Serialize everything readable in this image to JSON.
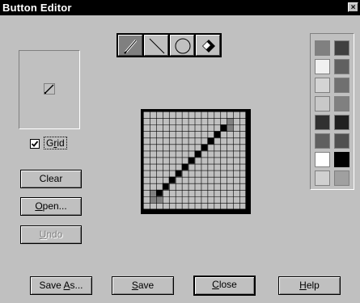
{
  "window": {
    "title": "Button Editor",
    "close_glyph": "×"
  },
  "tools": [
    {
      "name": "pencil-icon",
      "active": true
    },
    {
      "name": "line-icon",
      "active": false
    },
    {
      "name": "circle-icon",
      "active": false
    },
    {
      "name": "eraser-icon",
      "active": false
    }
  ],
  "grid": {
    "label_pre": "G",
    "label_ul": "r",
    "label_post": "id",
    "checked": true
  },
  "buttons": {
    "clear": {
      "ul": "",
      "rest": "Clear"
    },
    "open": {
      "ul": "O",
      "rest": "pen..."
    },
    "undo": {
      "ul": "U",
      "rest": "ndo"
    },
    "save_as_pre": "Save ",
    "save_as_ul": "A",
    "save_as_post": "s...",
    "save_ul": "S",
    "save_post": "ave",
    "close_ul": "C",
    "close_post": "lose",
    "help_ul": "H",
    "help_post": "elp"
  },
  "palette": [
    [
      "#808080",
      "#404040"
    ],
    [
      "#f0f0f0",
      "#606060"
    ],
    [
      "#d4d4d4",
      "#707070"
    ],
    [
      "#c8c8c8",
      "#808080"
    ],
    [
      "#303030",
      "#202020"
    ],
    [
      "#606060",
      "#505050"
    ],
    [
      "#ffffff",
      "#000000"
    ],
    [
      "#d0d0d0",
      "#a0a0a0"
    ]
  ],
  "pixel_grid": {
    "cols": 16,
    "rows": 15,
    "cells": [
      {
        "c": 13,
        "r": 1,
        "color": "#808080"
      },
      {
        "c": 12,
        "r": 2,
        "color": "#000000"
      },
      {
        "c": 13,
        "r": 2,
        "color": "#808080"
      },
      {
        "c": 11,
        "r": 3,
        "color": "#000000"
      },
      {
        "c": 10,
        "r": 4,
        "color": "#000000"
      },
      {
        "c": 9,
        "r": 5,
        "color": "#000000"
      },
      {
        "c": 8,
        "r": 6,
        "color": "#000000"
      },
      {
        "c": 7,
        "r": 7,
        "color": "#000000"
      },
      {
        "c": 6,
        "r": 8,
        "color": "#000000"
      },
      {
        "c": 5,
        "r": 9,
        "color": "#000000"
      },
      {
        "c": 4,
        "r": 10,
        "color": "#000000"
      },
      {
        "c": 3,
        "r": 11,
        "color": "#000000"
      },
      {
        "c": 2,
        "r": 12,
        "color": "#000000"
      },
      {
        "c": 1,
        "r": 12,
        "color": "#808080"
      },
      {
        "c": 1,
        "r": 13,
        "color": "#808080"
      },
      {
        "c": 2,
        "r": 13,
        "color": "#808080"
      }
    ]
  }
}
